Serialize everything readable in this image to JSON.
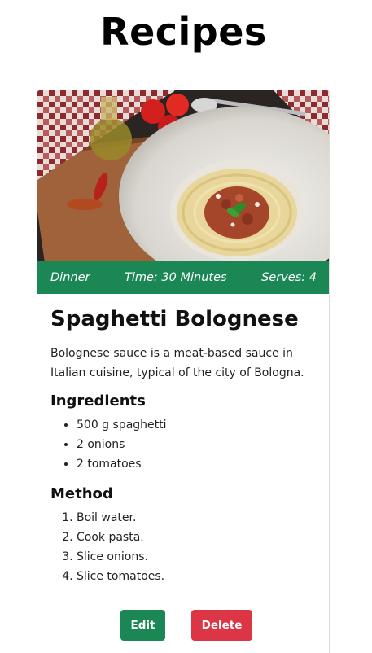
{
  "page": {
    "title": "Recipes"
  },
  "recipe": {
    "meta": {
      "category": "Dinner",
      "time": "Time: 30 Minutes",
      "serves": "Serves: 4"
    },
    "title": "Spaghetti Bolognese",
    "description": "Bolognese sauce is a meat-based sauce in Italian cuisine, typical of the city of Bologna.",
    "ingredients_heading": "Ingredients",
    "ingredients": [
      "500 g spaghetti",
      "2 onions",
      "2 tomatoes"
    ],
    "method_heading": "Method",
    "method": [
      "Boil water.",
      "Cook pasta.",
      "Slice onions.",
      "Slice tomatoes."
    ]
  },
  "actions": {
    "edit_label": "Edit",
    "delete_label": "Delete"
  },
  "colors": {
    "accent_green": "#1a8754",
    "danger_red": "#dc3545"
  }
}
